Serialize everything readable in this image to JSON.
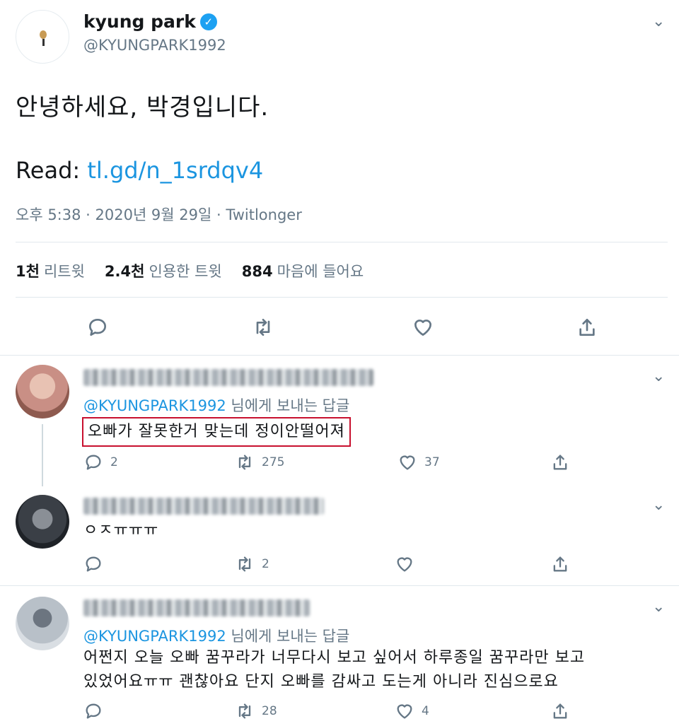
{
  "main_tweet": {
    "author_name": "kyung park",
    "handle": "@KYUNGPARK1992",
    "text": "안녕하세요, 박경입니다.",
    "read_label": "Read:",
    "read_link": "tl.gd/n_1srdqv4",
    "meta": "오후 5:38 · 2020년 9월 29일 · Twitlonger",
    "stats": {
      "retweets_count": "1천",
      "retweets_label": "리트윗",
      "quotes_count": "2.4천",
      "quotes_label": "인용한 트윗",
      "likes_count": "884",
      "likes_label": "마음에 들어요"
    },
    "icons": [
      "reply-icon",
      "retweet-icon",
      "like-icon",
      "share-icon"
    ]
  },
  "replies": [
    {
      "reply_to_handle": "@KYUNGPARK1992",
      "reply_to_suffix": "님에게 보내는 답글",
      "text": "오빠가 잘못한거 맞는데 정이안떨어져",
      "reply_count": "2",
      "retweet_count": "275",
      "like_count": "37"
    },
    {
      "text": "ㅇㅈㅠㅠㅠ",
      "reply_count": "",
      "retweet_count": "2",
      "like_count": ""
    },
    {
      "reply_to_handle": "@KYUNGPARK1992",
      "reply_to_suffix": "님에게 보내는 답글",
      "text_line1": "어쩐지 오늘 오빠 꿈꾸라가 너무다시 보고 싶어서 하루종일 꿈꾸라만 보고",
      "text_line2": "있었어요ㅠㅠ 괜찮아요 단지 오빠를 감싸고 도는게 아니라 진심으로요",
      "reply_count": "",
      "retweet_count": "28",
      "like_count": "4"
    }
  ],
  "colors": {
    "link": "#1b95e0",
    "verified": "#1da1f2",
    "highlight_box": "#c8102e",
    "muted": "#657786"
  }
}
